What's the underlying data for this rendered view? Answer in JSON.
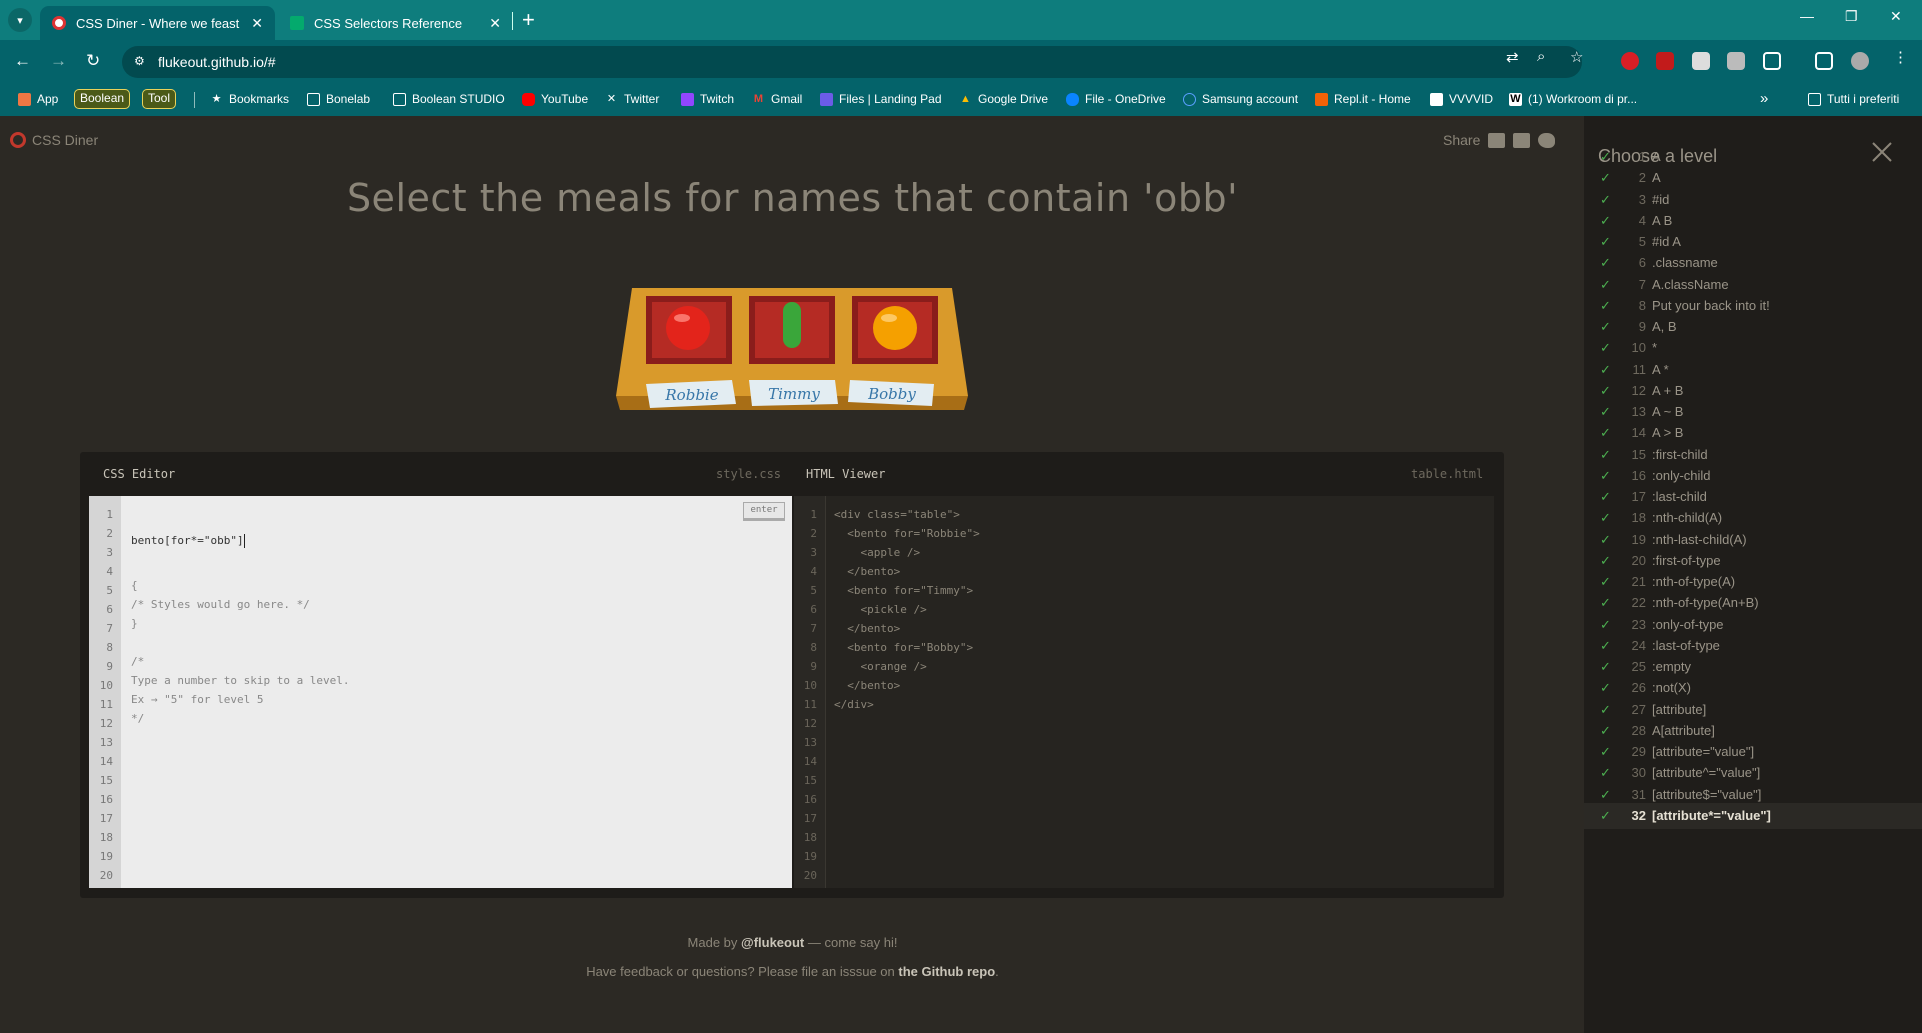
{
  "browser": {
    "tabs": [
      {
        "title": "CSS Diner - Where we feast on",
        "active": true
      },
      {
        "title": "CSS Selectors Reference",
        "active": false
      }
    ],
    "url": "flukeout.github.io/#",
    "bookmarks": {
      "apps": "App",
      "chips": [
        "Boolean",
        "Tool"
      ],
      "items": [
        "Bookmarks",
        "Bonelab",
        "Boolean STUDIO",
        "YouTube",
        "Twitter",
        "Twitch",
        "Gmail",
        "Files | Landing Pad",
        "Google Drive",
        "File - OneDrive",
        "Samsung account",
        "Repl.it - Home",
        "VVVVID",
        "(1) Workroom di pr..."
      ],
      "overflow": "»",
      "all_bookmarks": "Tutti i preferiti"
    }
  },
  "app": {
    "logo": "CSS Diner",
    "share": "Share",
    "order": "Select the meals for names that contain 'obb'",
    "table": {
      "bentos": [
        {
          "name": "Robbie",
          "food": "apple",
          "color": "#e3241b"
        },
        {
          "name": "Timmy",
          "food": "pickle",
          "color": "#3aa63a"
        },
        {
          "name": "Bobby",
          "food": "orange",
          "color": "#f5a000"
        }
      ]
    },
    "css_editor": {
      "title": "CSS Editor",
      "file": "style.css",
      "input": "bento[for*=\"obb\"]",
      "enter": "enter",
      "lines": [
        "{",
        "/* Styles would go here. */",
        "}",
        "",
        "/*",
        "Type a number to skip to a level.",
        "Ex → \"5\" for level 5",
        "*/"
      ],
      "line_numbers": [
        "1",
        "2",
        "3",
        "4",
        "5",
        "6",
        "7",
        "8",
        "9",
        "10",
        "11",
        "12",
        "13",
        "14",
        "15",
        "16",
        "17",
        "18",
        "19",
        "20"
      ]
    },
    "html_viewer": {
      "title": "HTML Viewer",
      "file": "table.html",
      "lines": [
        "<div class=\"table\">",
        "  <bento for=\"Robbie\">",
        "    <apple />",
        "  </bento>",
        "  <bento for=\"Timmy\">",
        "    <pickle />",
        "  </bento>",
        "  <bento for=\"Bobby\">",
        "    <orange />",
        "  </bento>",
        "</div>"
      ],
      "line_numbers": [
        "1",
        "2",
        "3",
        "4",
        "5",
        "6",
        "7",
        "8",
        "9",
        "10",
        "11",
        "12",
        "13",
        "14",
        "15",
        "16",
        "17",
        "18",
        "19",
        "20"
      ]
    },
    "credits": {
      "made_by_prefix": "Made by ",
      "author": "@flukeout",
      "made_by_suffix": " — come say hi!",
      "feedback_prefix": "Have feedback or questions? Please file an isssue on ",
      "repo": "the Github repo",
      "feedback_suffix": "."
    },
    "levels": {
      "title": "Choose a level",
      "current": 32,
      "items": [
        {
          "n": "1",
          "s": "A"
        },
        {
          "n": "2",
          "s": "A"
        },
        {
          "n": "3",
          "s": "#id"
        },
        {
          "n": "4",
          "s": "A B"
        },
        {
          "n": "5",
          "s": "#id  A"
        },
        {
          "n": "6",
          "s": ".classname"
        },
        {
          "n": "7",
          "s": "A.className"
        },
        {
          "n": "8",
          "s": "Put your back into it!"
        },
        {
          "n": "9",
          "s": "A, B"
        },
        {
          "n": "10",
          "s": "*"
        },
        {
          "n": "11",
          "s": "A *"
        },
        {
          "n": "12",
          "s": "A + B"
        },
        {
          "n": "13",
          "s": "A ~ B"
        },
        {
          "n": "14",
          "s": "A > B"
        },
        {
          "n": "15",
          "s": ":first-child"
        },
        {
          "n": "16",
          "s": ":only-child"
        },
        {
          "n": "17",
          "s": ":last-child"
        },
        {
          "n": "18",
          "s": ":nth-child(A)"
        },
        {
          "n": "19",
          "s": ":nth-last-child(A)"
        },
        {
          "n": "20",
          "s": ":first-of-type"
        },
        {
          "n": "21",
          "s": ":nth-of-type(A)"
        },
        {
          "n": "22",
          "s": ":nth-of-type(An+B)"
        },
        {
          "n": "23",
          "s": ":only-of-type"
        },
        {
          "n": "24",
          "s": ":last-of-type"
        },
        {
          "n": "25",
          "s": ":empty"
        },
        {
          "n": "26",
          "s": ":not(X)"
        },
        {
          "n": "27",
          "s": "[attribute]"
        },
        {
          "n": "28",
          "s": "A[attribute]"
        },
        {
          "n": "29",
          "s": "[attribute=\"value\"]"
        },
        {
          "n": "30",
          "s": "[attribute^=\"value\"]"
        },
        {
          "n": "31",
          "s": "[attribute$=\"value\"]"
        },
        {
          "n": "32",
          "s": "[attribute*=\"value\"]"
        }
      ]
    }
  }
}
